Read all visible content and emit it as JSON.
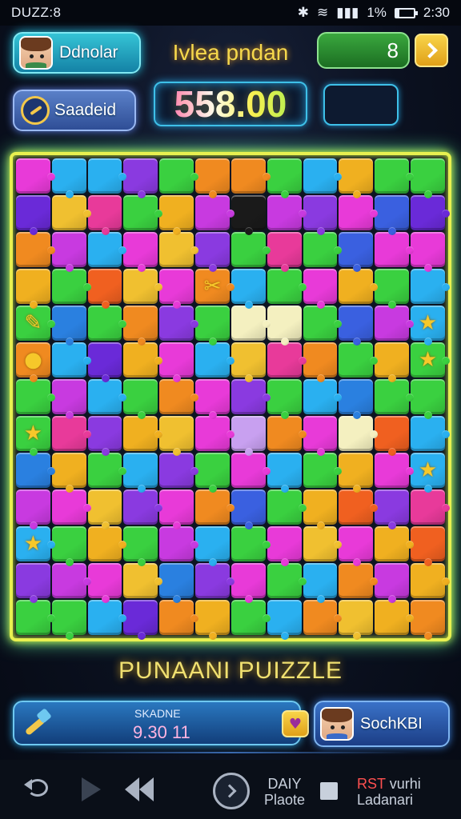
{
  "status_bar": {
    "app_label": "DUZZ:8",
    "battery_percent_text": "1%",
    "time": "2:30",
    "battery_level": 0.2
  },
  "header": {
    "player_name": "Ddnolar",
    "settings_label": "Saadeid",
    "level_title": "Ivlea pndan",
    "score": "558.00",
    "moves_value": "8"
  },
  "board": {
    "rows": 13,
    "cols": 12,
    "tiles": [
      [
        "#e83ad8",
        "#2ab0f0",
        "#2ab0f0",
        "#8a3ae0",
        "#3ad040",
        "#f08a20",
        "#f08a20",
        "#3ad040",
        "#2ab0f0",
        "#f0b020",
        "#3ad040",
        "#3ad040"
      ],
      [
        "#6a2ad8",
        "#f0c030",
        "#e83a9a",
        "#3ad040",
        "#f0b020",
        "#c83ae0",
        "#1a1a1a",
        "#c83ae0",
        "#8a3ae0",
        "#e83ad8",
        "#3a60e0",
        "#6a2ad8"
      ],
      [
        "#f08a20",
        "#c83ae0",
        "#2ab0f0",
        "#e83ad8",
        "#f0c030",
        "#8a3ae0",
        "#3ad040",
        "#e83a9a",
        "#3ad040",
        "#3a60e0",
        "#e83ad8",
        "#e83ad8"
      ],
      [
        "#f0b020",
        "#3ad040",
        "#f06020",
        "#f0c030",
        "#e83ad8",
        "#f08a20",
        "#2ab0f0",
        "#3ad040",
        "#e83ad8",
        "#f0b020",
        "#3ad040",
        "#2ab0f0"
      ],
      [
        "#3ad040",
        "#2a80e0",
        "#3ad040",
        "#f08a20",
        "#8a3ae0",
        "#3ad040",
        "#f4f0c0",
        "#f4f0c0",
        "#3ad040",
        "#3a60e0",
        "#c83ae0",
        "#2ab0f0"
      ],
      [
        "#f08a20",
        "#2ab0f0",
        "#6a2ad8",
        "#f0b020",
        "#e83ad8",
        "#2ab0f0",
        "#f0c030",
        "#e83a9a",
        "#f08a20",
        "#3ad040",
        "#f0b020",
        "#3ad040"
      ],
      [
        "#3ad040",
        "#c83ae0",
        "#2ab0f0",
        "#3ad040",
        "#f08a20",
        "#e83ad8",
        "#8a3ae0",
        "#3ad040",
        "#2ab0f0",
        "#2a80e0",
        "#3ad040",
        "#3ad040"
      ],
      [
        "#3ad040",
        "#e83a9a",
        "#8a3ae0",
        "#f0b020",
        "#f0c030",
        "#e83ad8",
        "#c8a0f0",
        "#f08a20",
        "#e83ad8",
        "#f4f0c0",
        "#f06020",
        "#2ab0f0"
      ],
      [
        "#2a80e0",
        "#f0b020",
        "#3ad040",
        "#2ab0f0",
        "#8a3ae0",
        "#3ad040",
        "#e83ad8",
        "#2ab0f0",
        "#3ad040",
        "#f0b020",
        "#e83ad8",
        "#2ab0f0"
      ],
      [
        "#c83ae0",
        "#e83ad8",
        "#f0c030",
        "#8a3ae0",
        "#e83ad8",
        "#f08a20",
        "#3a60e0",
        "#3ad040",
        "#f0b020",
        "#f06020",
        "#8a3ae0",
        "#e83a9a"
      ],
      [
        "#2ab0f0",
        "#3ad040",
        "#f0b020",
        "#3ad040",
        "#c83ae0",
        "#2ab0f0",
        "#3ad040",
        "#e83ad8",
        "#f0c030",
        "#e83ad8",
        "#f0b020",
        "#f06020"
      ],
      [
        "#8a3ae0",
        "#c83ae0",
        "#e83ad8",
        "#f0c030",
        "#2a80e0",
        "#8a3ae0",
        "#e83ad8",
        "#3ad040",
        "#2ab0f0",
        "#f08a20",
        "#c83ae0",
        "#f0b020"
      ],
      [
        "#3ad040",
        "#3ad040",
        "#2ab0f0",
        "#6a2ad8",
        "#f08a20",
        "#f0b020",
        "#3ad040",
        "#2ab0f0",
        "#f08a20",
        "#f0c030",
        "#f0b020",
        "#f08a20"
      ]
    ],
    "icons": [
      {
        "row": 3,
        "col": 5,
        "glyph": "✂",
        "name": "scissors-icon"
      },
      {
        "row": 4,
        "col": 0,
        "glyph": "✎",
        "name": "pencil-icon"
      },
      {
        "row": 4,
        "col": 11,
        "glyph": "★",
        "name": "star-icon"
      },
      {
        "row": 5,
        "col": 0,
        "glyph": "●",
        "name": "gem-icon"
      },
      {
        "row": 5,
        "col": 11,
        "glyph": "★",
        "name": "star-icon"
      },
      {
        "row": 7,
        "col": 0,
        "glyph": "★",
        "name": "star-icon"
      },
      {
        "row": 8,
        "col": 11,
        "glyph": "★",
        "name": "star-icon"
      },
      {
        "row": 10,
        "col": 0,
        "glyph": "★",
        "name": "star-icon"
      }
    ]
  },
  "game_title": "PUNAANI PUIZZLE",
  "bottom": {
    "bar_label": "SKADNE",
    "bar_value": "9.30 11",
    "profile_label": "SochKBI"
  },
  "nav": {
    "center_text_line1": "DAIY",
    "center_text_line2": "Plaote",
    "right_accent": "RST",
    "right_line1_rest": " vurhi",
    "right_line2": "Ladanari"
  }
}
